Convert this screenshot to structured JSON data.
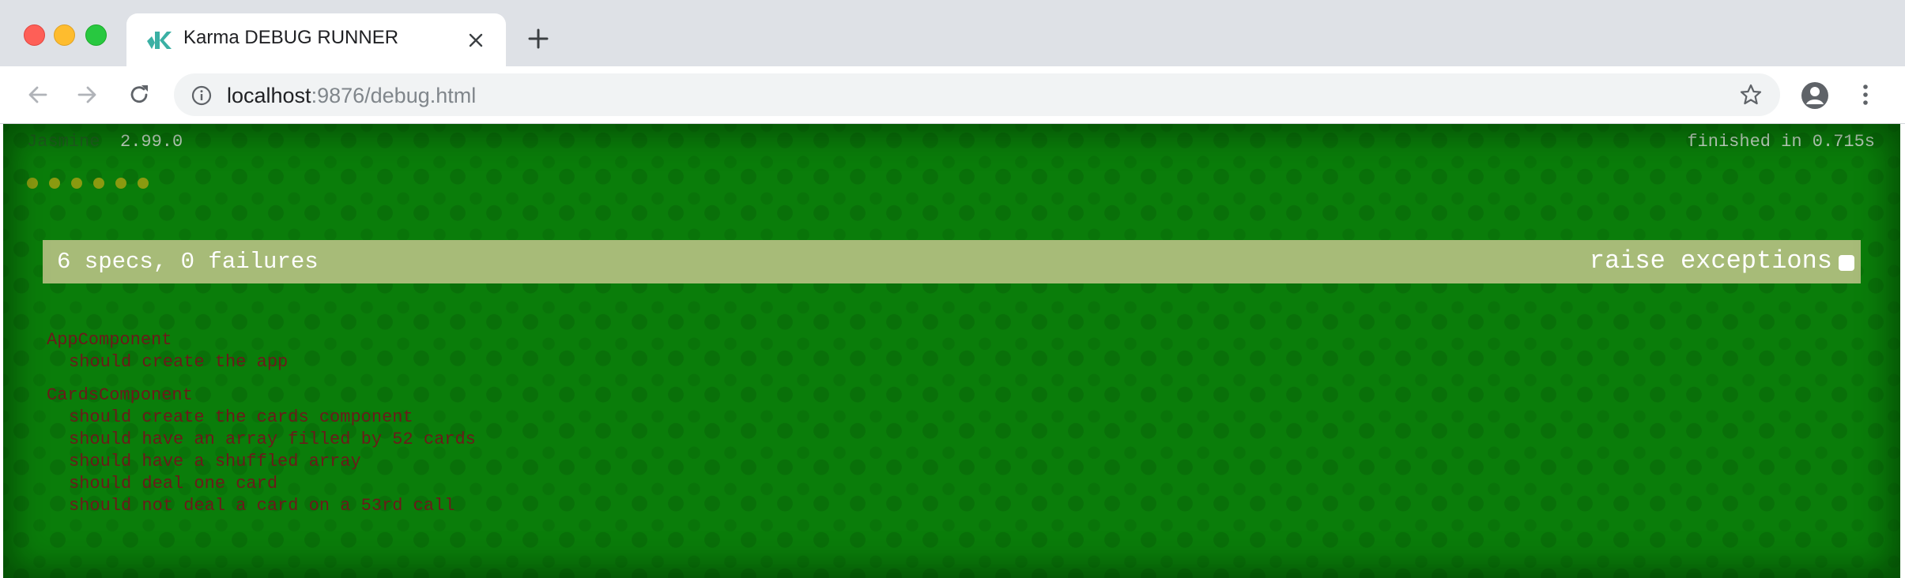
{
  "browser": {
    "tab": {
      "title": "Karma DEBUG RUNNER",
      "favicon": "karma-logo-icon"
    },
    "address": {
      "host": "localhost",
      "path": ":9876/debug.html"
    }
  },
  "jasmine": {
    "title": "Jasmine",
    "version": "2.99.0",
    "duration": "finished in 0.715s",
    "symbols_count": 6,
    "summary": "6 specs, 0 failures",
    "raise_exceptions_label": "raise exceptions",
    "raise_exceptions_checked": false,
    "suites": [
      {
        "name": "AppComponent",
        "specs": [
          "should create the app"
        ]
      },
      {
        "name": "CardsComponent",
        "specs": [
          "should create the cards component",
          "should have an array filled by 52 cards",
          "should have a shuffled array",
          "should deal one card",
          "should not deal a card on a 53rd call"
        ]
      }
    ]
  },
  "colors": {
    "page_bg": "#0a7d0a",
    "alert_bar": "#a7bb78",
    "spec_text": "#6b1a1a",
    "passed_dot": "#8a9a10"
  }
}
